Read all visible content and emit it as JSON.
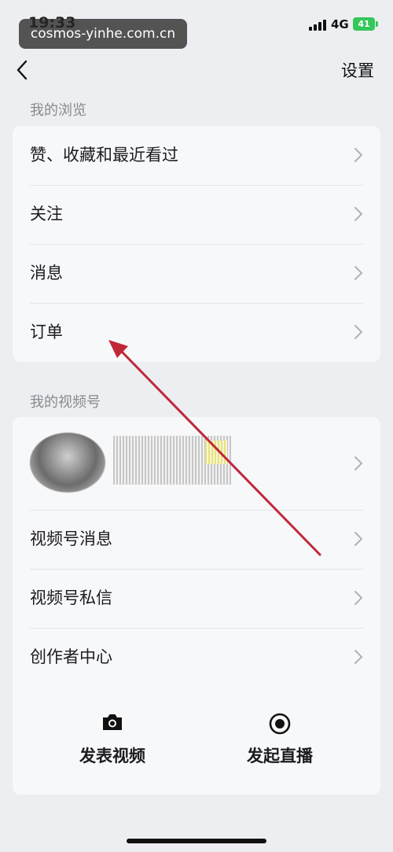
{
  "status_bar": {
    "time": "19:33",
    "network": "4G",
    "battery": "41"
  },
  "watermark": "cosmos-yinhe.com.cn",
  "nav": {
    "title": "设置"
  },
  "section_browse": {
    "title": "我的浏览",
    "items": [
      {
        "label": "赞、收藏和最近看过"
      },
      {
        "label": "关注"
      },
      {
        "label": "消息"
      },
      {
        "label": "订单"
      }
    ]
  },
  "section_channels": {
    "title": "我的视频号",
    "items": [
      {
        "label": "视频号消息"
      },
      {
        "label": "视频号私信"
      },
      {
        "label": "创作者中心"
      }
    ],
    "actions": [
      {
        "label": "发表视频",
        "icon": "camera-icon"
      },
      {
        "label": "发起直播",
        "icon": "live-record-icon"
      }
    ]
  },
  "annotation": {
    "color": "#c0283a"
  }
}
